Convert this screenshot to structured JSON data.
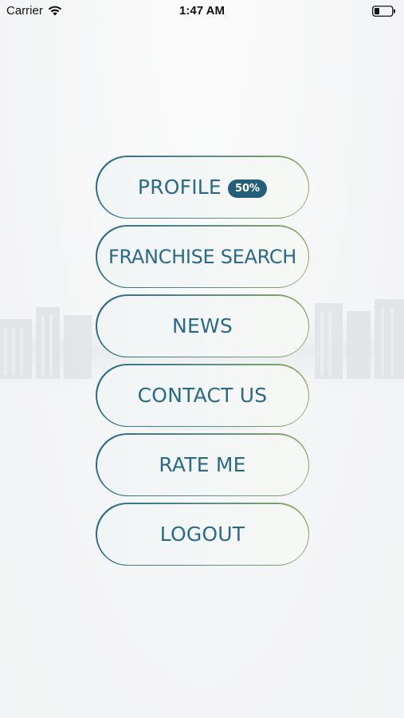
{
  "status_bar": {
    "carrier": "Carrier",
    "time": "1:47 AM",
    "wifi_icon": "wifi-icon",
    "battery_icon": "battery-icon"
  },
  "menu": {
    "profile": {
      "label": "PROFILE",
      "badge": "50%"
    },
    "franchise_search": {
      "label": "FRANCHISE SEARCH"
    },
    "news": {
      "label": "NEWS"
    },
    "contact_us": {
      "label": "CONTACT US"
    },
    "rate_me": {
      "label": "RATE ME"
    },
    "logout": {
      "label": "LOGOUT"
    }
  },
  "colors": {
    "accent_text": "#2b6a87",
    "border_start": "#2b6a8a",
    "border_end": "#8aa85a",
    "badge_bg": "#245f7a"
  }
}
